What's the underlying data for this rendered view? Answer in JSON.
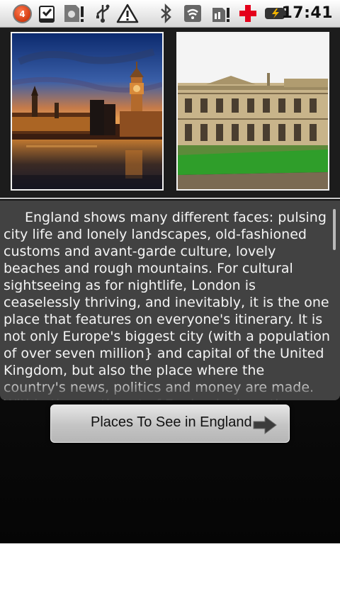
{
  "status_bar": {
    "notification_count": "4",
    "time": "17:41",
    "icons": [
      "notification-badge-icon",
      "download-complete-icon",
      "sd-card-alert-icon",
      "usb-icon",
      "warning-icon",
      "bluetooth-icon",
      "wifi-icon",
      "sim-alert-icon",
      "red-cross-icon",
      "battery-charging-icon"
    ]
  },
  "gallery": {
    "images": [
      {
        "name": "palace-of-westminster-night",
        "kind": "photo"
      },
      {
        "name": "college-building-lawn",
        "kind": "photo"
      }
    ]
  },
  "description": {
    "text": "England shows many different faces: pulsing city life and lonely landscapes, old-fashioned customs and avant-garde culture, lovely beaches and rough mountains. For cultural sightseeing as for nightlife, London is ceaselessly thriving, and inevitably, it is the one place that features on everyone's itinerary. It is not only Europe's biggest city (with a population of over seven million} and capital of the United Kingdom, but also the place where the country's news, politics and money are made. Within the southeast of England, along the"
  },
  "button": {
    "label": "Places To See in England",
    "icon": "arrow-right-icon"
  },
  "colors": {
    "panel": "#424242",
    "background": "#111111",
    "button": "#c8c8c8"
  }
}
